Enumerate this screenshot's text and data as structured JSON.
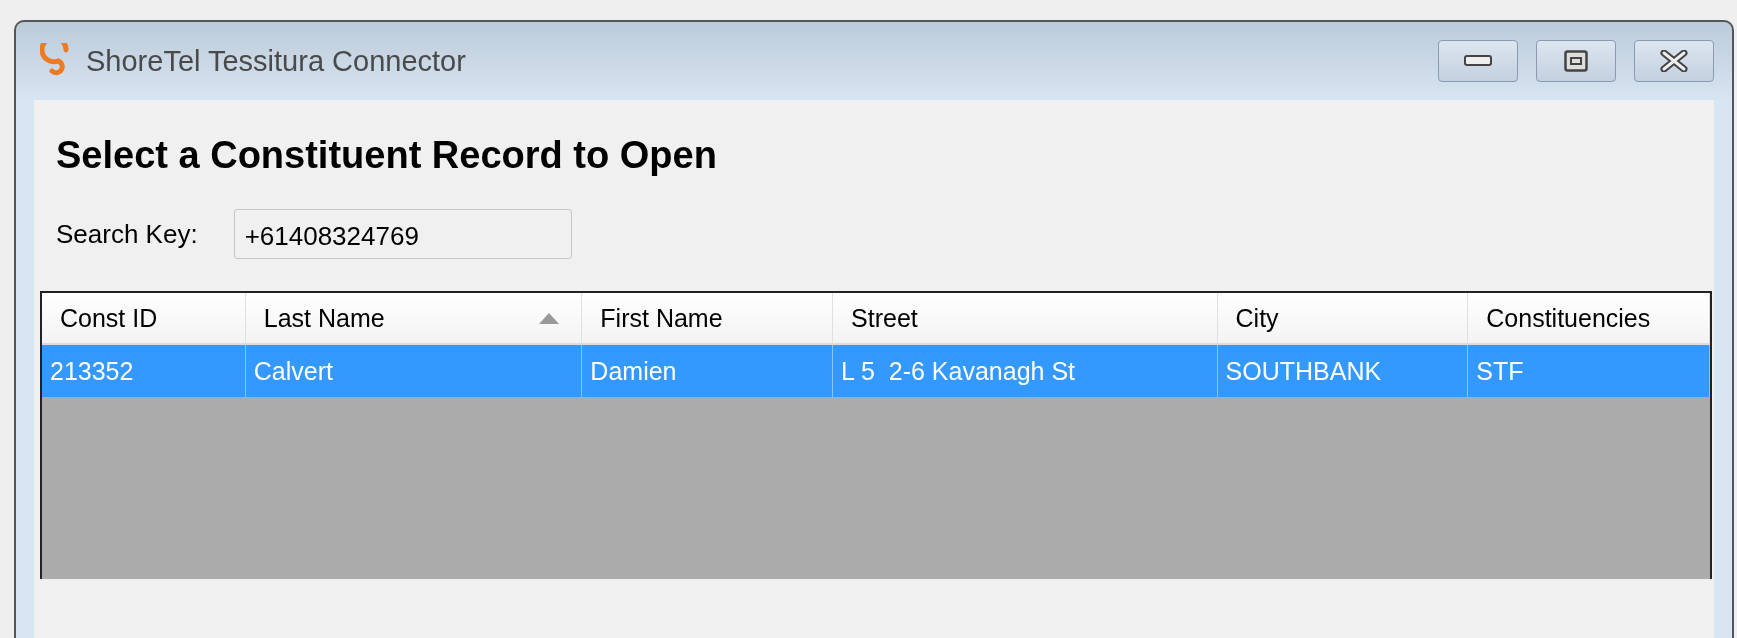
{
  "window": {
    "title": "ShoreTel Tessitura Connector"
  },
  "heading": "Select a Constituent Record to Open",
  "search": {
    "label": "Search Key:",
    "value": "+61408324769"
  },
  "table": {
    "columns": [
      {
        "label": "Const ID",
        "sorted": false
      },
      {
        "label": "Last Name",
        "sorted": true
      },
      {
        "label": "First Name",
        "sorted": false
      },
      {
        "label": "Street",
        "sorted": false
      },
      {
        "label": "City",
        "sorted": false
      },
      {
        "label": "Constituencies",
        "sorted": false
      }
    ],
    "rows": [
      {
        "selected": true,
        "cells": [
          "213352",
          "Calvert",
          "Damien",
          "L 5  2-6 Kavanagh St",
          "SOUTHBANK",
          "STF"
        ]
      }
    ]
  }
}
